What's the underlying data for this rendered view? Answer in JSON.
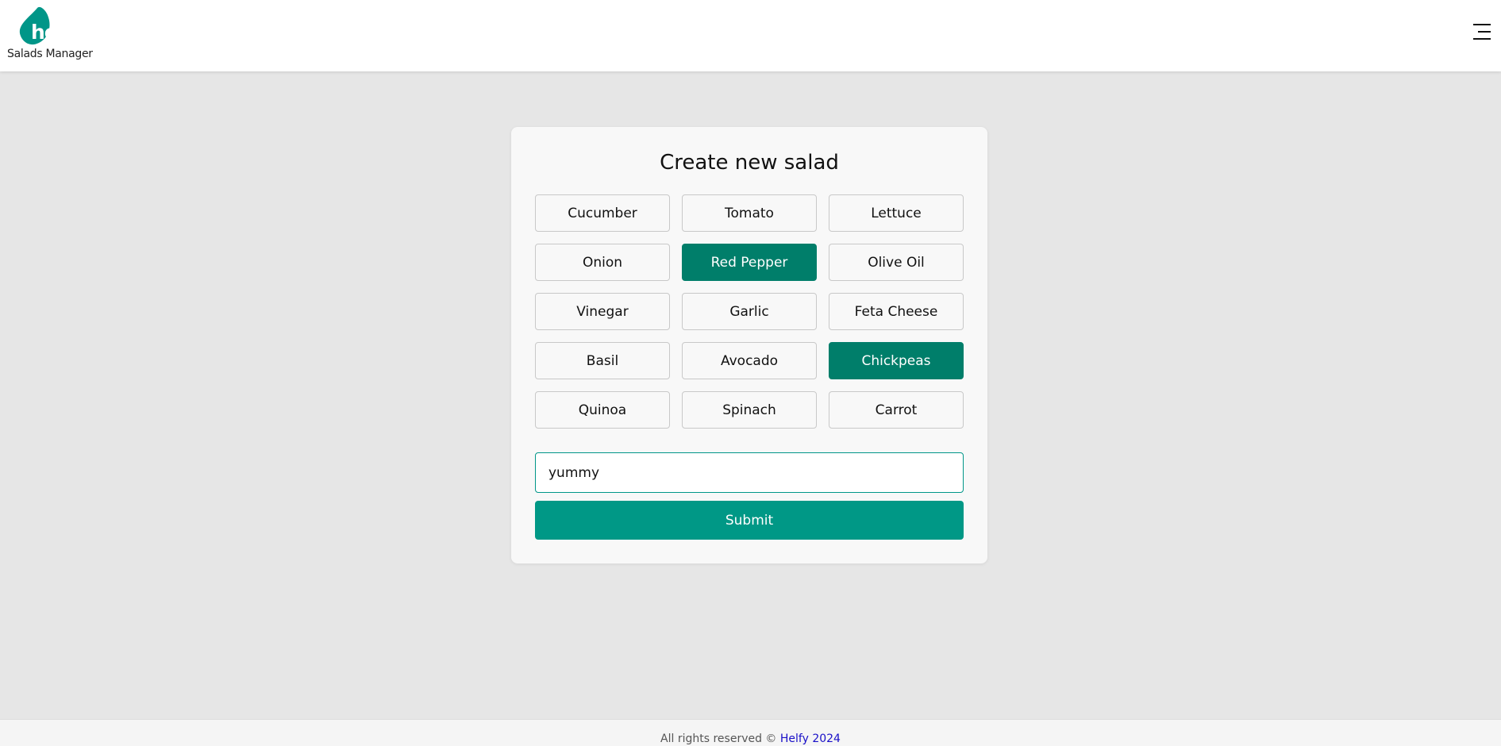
{
  "header": {
    "logo_text": "helfy",
    "subtitle": "Salads Manager",
    "menu_icon": "hamburger-menu-icon"
  },
  "form": {
    "title": "Create new salad",
    "ingredients": [
      {
        "label": "Cucumber",
        "selected": false
      },
      {
        "label": "Tomato",
        "selected": false
      },
      {
        "label": "Lettuce",
        "selected": false
      },
      {
        "label": "Onion",
        "selected": false
      },
      {
        "label": "Red Pepper",
        "selected": true
      },
      {
        "label": "Olive Oil",
        "selected": false
      },
      {
        "label": "Vinegar",
        "selected": false
      },
      {
        "label": "Garlic",
        "selected": false
      },
      {
        "label": "Feta Cheese",
        "selected": false
      },
      {
        "label": "Basil",
        "selected": false
      },
      {
        "label": "Avocado",
        "selected": false
      },
      {
        "label": "Chickpeas",
        "selected": true
      },
      {
        "label": "Quinoa",
        "selected": false
      },
      {
        "label": "Spinach",
        "selected": false
      },
      {
        "label": "Carrot",
        "selected": false
      }
    ],
    "name_value": "yummy",
    "submit_label": "Submit"
  },
  "footer": {
    "text": "All rights reserved © ",
    "brand": "Helfy 2024"
  },
  "colors": {
    "accent": "#009688",
    "selected": "#007e6a",
    "footer_link": "#1a10c8",
    "background": "#e6e6e6"
  }
}
